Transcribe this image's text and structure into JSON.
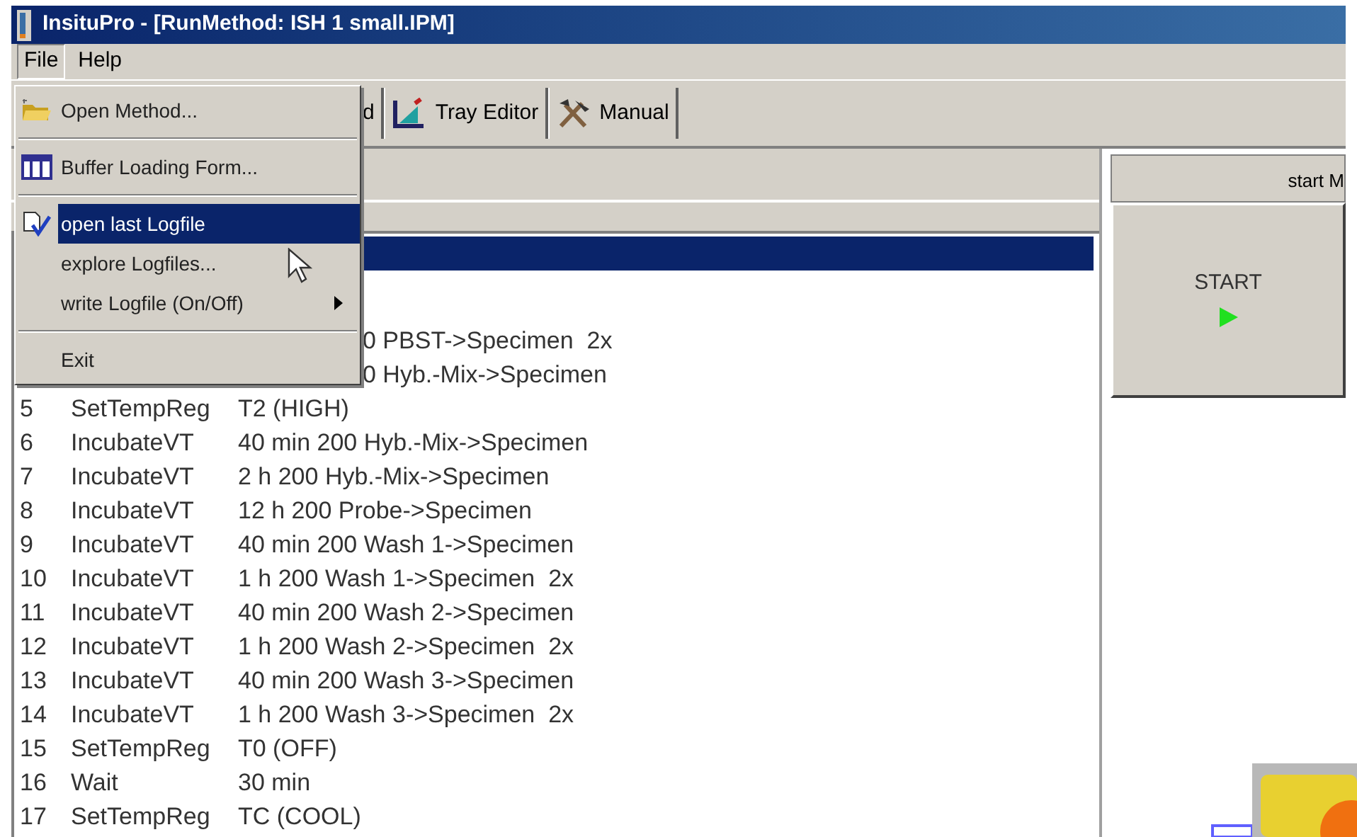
{
  "window": {
    "title": "InsituPro - [RunMethod: ISH 1 small.IPM]"
  },
  "menu_bar": [
    {
      "label": "File",
      "selected": true
    },
    {
      "label": "Help",
      "selected": false
    }
  ],
  "toolbar": [
    {
      "label": "d"
    },
    {
      "label": "Tray Editor"
    },
    {
      "label": "Manual"
    }
  ],
  "file_menu": [
    {
      "kind": "item",
      "label": "Open Method...",
      "selected": false
    },
    {
      "kind": "separator"
    },
    {
      "kind": "item",
      "label": "Buffer Loading Form...",
      "selected": false
    },
    {
      "kind": "separator"
    },
    {
      "kind": "item",
      "label": "open last Logfile",
      "selected": true
    },
    {
      "kind": "item",
      "label": "explore Logfiles...",
      "selected": false
    },
    {
      "kind": "submenu",
      "label": "write Logfile (On/Off)",
      "selected": false
    },
    {
      "kind": "separator"
    },
    {
      "kind": "item",
      "label": "Exit",
      "selected": false
    }
  ],
  "steps": [
    {
      "kind": "clipped",
      "params": "0 PBST->Specimen  2x"
    },
    {
      "kind": "clipped",
      "params": "0 Hyb.-Mix->Specimen"
    },
    {
      "kind": "full",
      "number": "5",
      "command": "SetTempReg",
      "params": "T2 (HIGH)"
    },
    {
      "kind": "full",
      "number": "6",
      "command": "IncubateVT",
      "params": "40 min 200 Hyb.-Mix->Specimen"
    },
    {
      "kind": "full",
      "number": "7",
      "command": "IncubateVT",
      "params": "2 h 200 Hyb.-Mix->Specimen"
    },
    {
      "kind": "full",
      "number": "8",
      "command": "IncubateVT",
      "params": "12 h 200 Probe->Specimen"
    },
    {
      "kind": "full",
      "number": "9",
      "command": "IncubateVT",
      "params": "40 min 200 Wash 1->Specimen"
    },
    {
      "kind": "full",
      "number": "10",
      "command": "IncubateVT",
      "params": "1 h 200 Wash 1->Specimen  2x"
    },
    {
      "kind": "full",
      "number": "11",
      "command": "IncubateVT",
      "params": "40 min 200 Wash 2->Specimen"
    },
    {
      "kind": "full",
      "number": "12",
      "command": "IncubateVT",
      "params": "1 h 200 Wash 2->Specimen  2x"
    },
    {
      "kind": "full",
      "number": "13",
      "command": "IncubateVT",
      "params": "40 min 200 Wash 3->Specimen"
    },
    {
      "kind": "full",
      "number": "14",
      "command": "IncubateVT",
      "params": "1 h 200 Wash 3->Specimen  2x"
    },
    {
      "kind": "full",
      "number": "15",
      "command": "SetTempReg",
      "params": "T0 (OFF)"
    },
    {
      "kind": "full",
      "number": "16",
      "command": "Wait",
      "params": "30 min"
    },
    {
      "kind": "full",
      "number": "17",
      "command": "SetTempReg",
      "params": "TC (COOL)"
    }
  ],
  "right_panel": {
    "header": "start M",
    "start_button": "START"
  }
}
